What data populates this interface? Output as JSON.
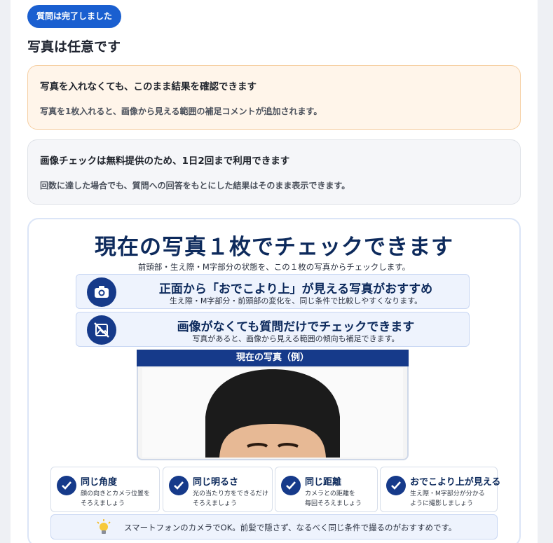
{
  "status_badge": "質問は完了しました",
  "page_title": "写真は任意です",
  "notice_optional": {
    "heading": "写真を入れなくても、このまま結果を確認できます",
    "body": "写真を1枚入れると、画像から見える範囲の補足コメントが追加されます。"
  },
  "notice_limit": {
    "heading": "画像チェックは無料提供のため、1日2回まで利用できます",
    "body": "回数に達した場合でも、質問への回答をもとにした結果はそのまま表示できます。"
  },
  "promo": {
    "title": "現在の写真１枚でチェックできます",
    "subtitle": "前頭部・生え際・M字部分の状態を、この１枚の写真からチェックします。",
    "tips": [
      {
        "icon": "camera-icon",
        "heading": "正面から「おでこより上」が見える写真がおすすめ",
        "sub": "生え際・M字部分・前頭部の変化を、同じ条件で比較しやすくなります。"
      },
      {
        "icon": "no-image-icon",
        "heading": "画像がなくても質問だけでチェックできます",
        "sub": "写真があると、画像から見える範囲の傾向も補足できます。"
      }
    ],
    "photo_label": "現在の写真（例）",
    "checks": [
      {
        "heading": "同じ角度",
        "sub": "顔の向きとカメラ位置を\nそろえましょう"
      },
      {
        "heading": "同じ明るさ",
        "sub": "光の当たり方をできるだけ\nそろえましょう"
      },
      {
        "heading": "同じ距離",
        "sub": "カメラとの距離を\n毎回そろえましょう"
      },
      {
        "heading": "おでこより上が見える",
        "sub": "生え際・M字部分が分かる\nように撮影しましょう"
      }
    ],
    "footer": "スマートフォンのカメラでOK。前髪で隠さず、なるべく同じ条件で撮るのがおすすめです。"
  },
  "colors": {
    "accent": "#1a5fd0",
    "navy": "#163a8a",
    "notice_orange_bg": "#fff5ea",
    "notice_gray_bg": "#f5f6f9"
  }
}
